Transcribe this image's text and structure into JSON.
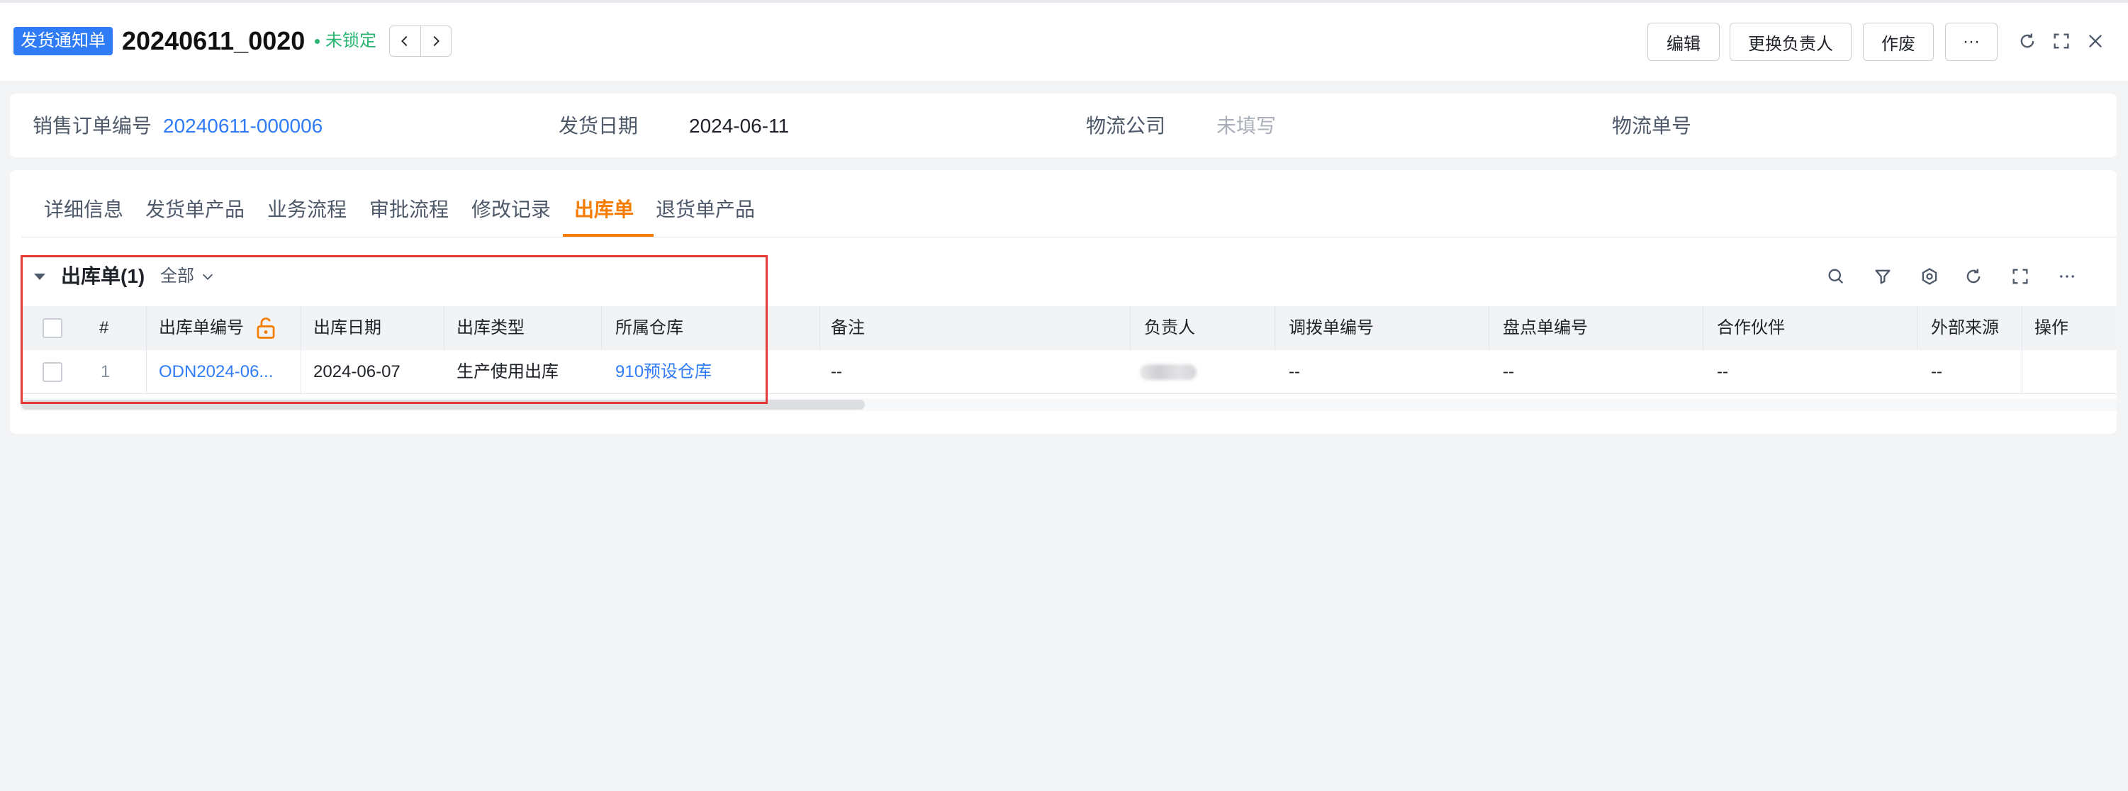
{
  "header": {
    "doc_type": "发货通知单",
    "doc_no": "20240611_0020",
    "lock_status": "未锁定",
    "buttons": {
      "edit": "编辑",
      "change_owner": "更换负责人",
      "void": "作废",
      "more": "···"
    },
    "icons": [
      "refresh-icon",
      "fullscreen-icon",
      "close-icon"
    ]
  },
  "info": {
    "sales_order_label": "销售订单编号",
    "sales_order_value": "20240611-000006",
    "ship_date_label": "发货日期",
    "ship_date_value": "2024-06-11",
    "logistics_company_label": "物流公司",
    "logistics_company_value": "未填写",
    "logistics_no_label": "物流单号",
    "logistics_no_value": ""
  },
  "tabs": [
    {
      "label": "详细信息",
      "active": false
    },
    {
      "label": "发货单产品",
      "active": false
    },
    {
      "label": "业务流程",
      "active": false
    },
    {
      "label": "审批流程",
      "active": false
    },
    {
      "label": "修改记录",
      "active": false
    },
    {
      "label": "出库单",
      "active": true
    },
    {
      "label": "退货单产品",
      "active": false
    }
  ],
  "section": {
    "title": "出库单(1)",
    "scope": "全部",
    "toolbar_icons": [
      "search-icon",
      "filter-icon",
      "settings-icon",
      "refresh-icon",
      "fullscreen-icon",
      "more-icon"
    ]
  },
  "table": {
    "columns": [
      "#",
      "出库单编号",
      "出库日期",
      "出库类型",
      "所属仓库",
      "备注",
      "负责人",
      "调拨单编号",
      "盘点单编号",
      "合作伙伴",
      "外部来源",
      "操作"
    ],
    "rows": [
      {
        "index": "1",
        "outbound_no": "ODN2024-06...",
        "outbound_date": "2024-06-07",
        "outbound_type": "生产使用出库",
        "warehouse": "910预设仓库",
        "remark": "--",
        "owner": "",
        "transfer_no": "--",
        "inventory_no": "--",
        "partner": "--",
        "external_source": "--",
        "action": ""
      }
    ]
  },
  "colors": {
    "accent": "#f57c00",
    "link": "#2f7cf6",
    "tag_bg": "#2f7cf6",
    "unlocked": "#2bb673",
    "highlight": "#e53935"
  }
}
